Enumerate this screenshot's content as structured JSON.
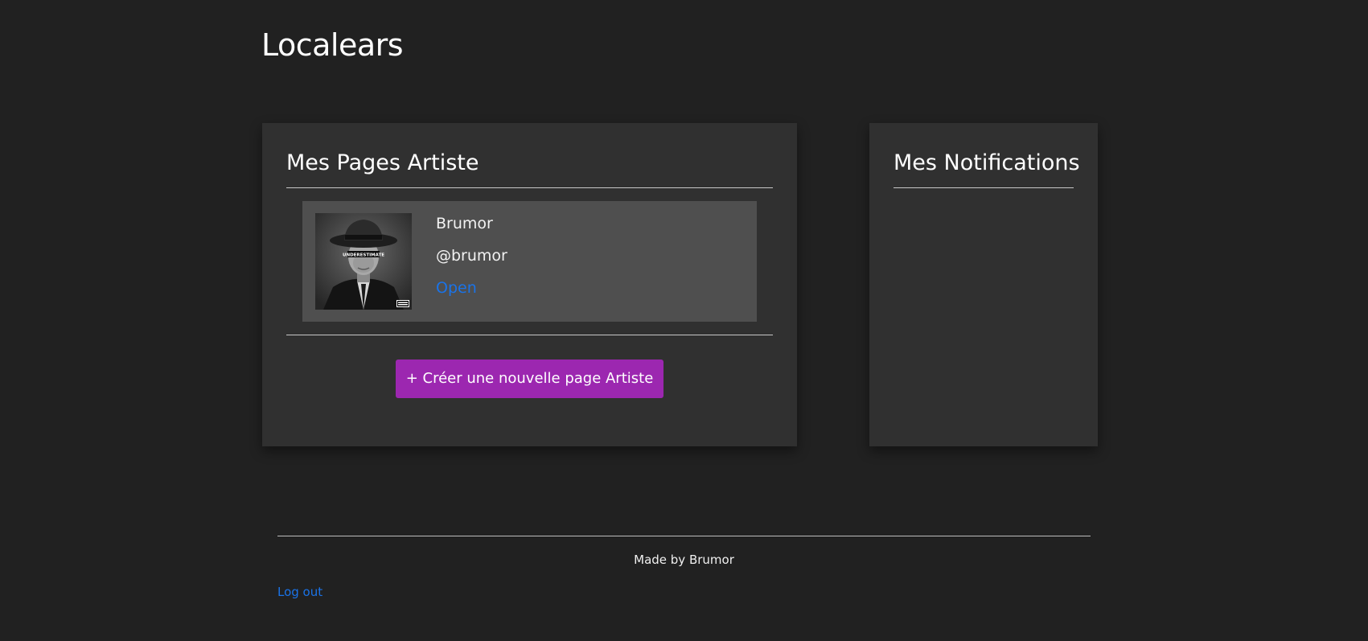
{
  "app": {
    "title": "Localears"
  },
  "artist_pages": {
    "title": "Mes Pages Artiste",
    "items": [
      {
        "name": "Brumor",
        "handle": "@brumor",
        "open_label": "Open",
        "avatar_caption": "UNDERESTIMATE"
      }
    ],
    "create_label": "+ Créer une nouvelle page Artiste"
  },
  "notifications": {
    "title": "Mes Notifications",
    "items": []
  },
  "footer": {
    "credit": "Made by Brumor",
    "logout_label": "Log out"
  },
  "colors": {
    "background": "#212121",
    "card": "#303030",
    "artist_item": "#4f4f4f",
    "accent": "#9c27b0",
    "link": "#1a73e8"
  }
}
